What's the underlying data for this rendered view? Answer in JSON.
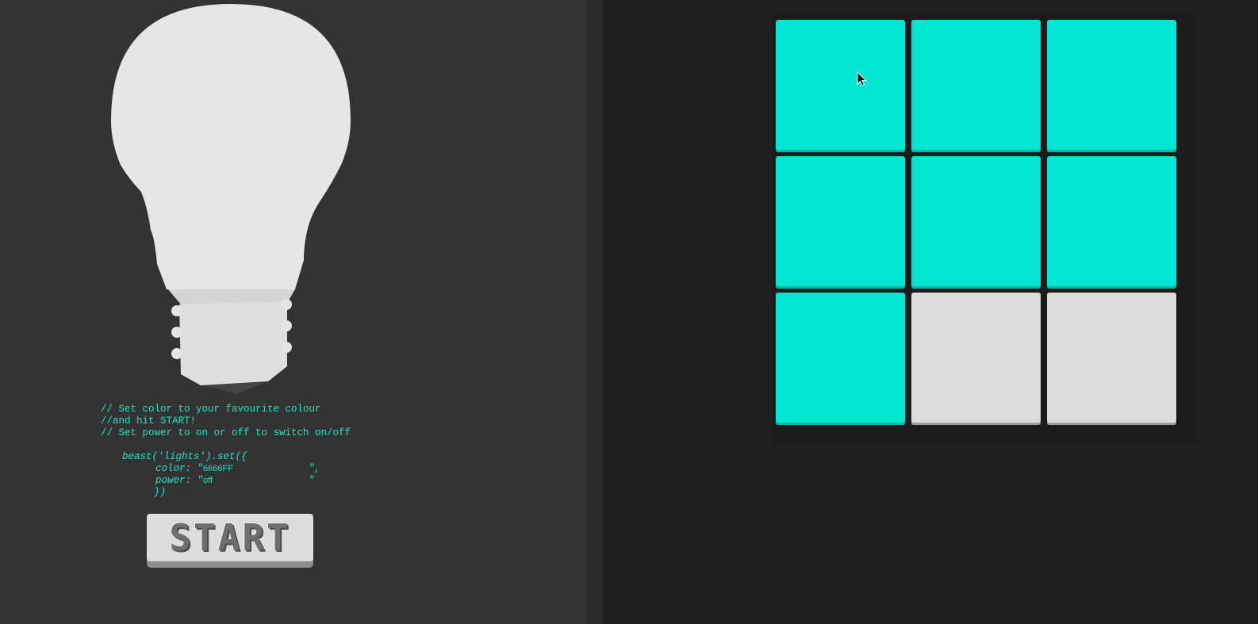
{
  "bulb": {
    "icon": "light-bulb-icon",
    "glass_color": "#e6e6e6",
    "base_color": "#d9d9d9"
  },
  "code": {
    "comment_lines": [
      "// Set color to your favourite colour",
      "//and hit START!",
      "// Set power to on or off to switch on/off"
    ],
    "call_open": "beast('lights').set({",
    "color_key": "color: ",
    "color_value": "6666FF",
    "power_key": "power: ",
    "power_value": "off",
    "call_close": "})",
    "text_color": "#16e8c6"
  },
  "start_button": {
    "label": "START"
  },
  "grid": {
    "lit_color": "#01e6d2",
    "off_color": "#dcdcdc",
    "tiles": [
      {
        "state": "lit"
      },
      {
        "state": "lit"
      },
      {
        "state": "lit"
      },
      {
        "state": "lit"
      },
      {
        "state": "lit"
      },
      {
        "state": "lit"
      },
      {
        "state": "lit"
      },
      {
        "state": "off"
      },
      {
        "state": "off"
      }
    ]
  },
  "cursor": {
    "icon": "mouse-pointer-icon"
  }
}
